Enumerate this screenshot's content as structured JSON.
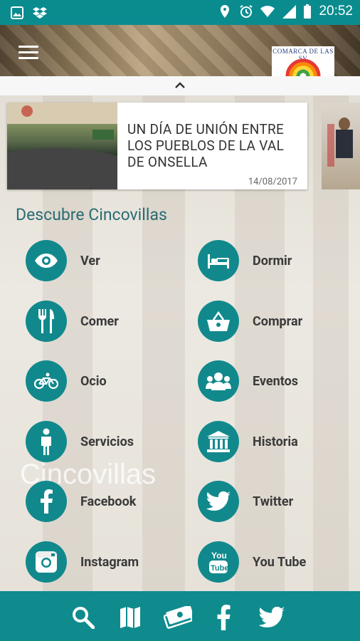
{
  "status_bar": {
    "time": "20:52"
  },
  "logo": {
    "text": "COMARCA DE LAS SV"
  },
  "news": {
    "title": "UN DÍA DE UNIÓN ENTRE LOS PUEBLOS DE LA VAL DE ONSELLA",
    "date": "14/08/2017"
  },
  "background_text": "Cincovillas",
  "section": {
    "title": "Descubre Cincovillas"
  },
  "menu": [
    {
      "label": "Ver",
      "icon": "eye-icon"
    },
    {
      "label": "Dormir",
      "icon": "bed-icon"
    },
    {
      "label": "Comer",
      "icon": "cutlery-icon"
    },
    {
      "label": "Comprar",
      "icon": "basket-icon"
    },
    {
      "label": "Ocio",
      "icon": "bicycle-icon"
    },
    {
      "label": "Eventos",
      "icon": "people-icon"
    },
    {
      "label": "Servicios",
      "icon": "person-icon"
    },
    {
      "label": "Historia",
      "icon": "museum-icon"
    },
    {
      "label": "Facebook",
      "icon": "facebook-icon"
    },
    {
      "label": "Twitter",
      "icon": "twitter-icon"
    },
    {
      "label": "Instagram",
      "icon": "instagram-icon"
    },
    {
      "label": "You Tube",
      "icon": "youtube-icon"
    }
  ],
  "bottom_bar": [
    "search-icon",
    "map-icon",
    "money-icon",
    "facebook-icon",
    "twitter-icon"
  ],
  "colors": {
    "accent": "#0f8b8e",
    "status_bar": "#0a8c8f",
    "section_title": "#2a6b72"
  }
}
